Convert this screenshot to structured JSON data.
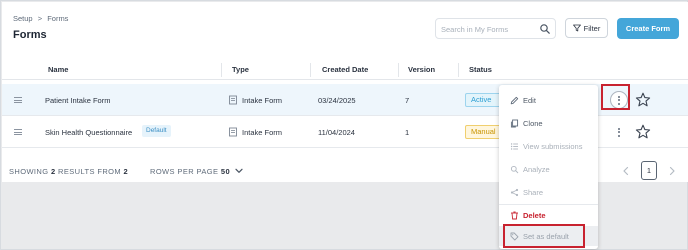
{
  "breadcrumb": {
    "root": "Setup",
    "separator": ">",
    "current": "Forms"
  },
  "page_title": "Forms",
  "search": {
    "placeholder": "Search in My Forms",
    "value": ""
  },
  "toolbar": {
    "filter_label": "Filter",
    "create_label": "Create Form"
  },
  "table": {
    "columns": [
      "Name",
      "Type",
      "Created Date",
      "Version",
      "Status"
    ],
    "rows": [
      {
        "name": "Patient Intake Form",
        "badge": "",
        "type": "Intake Form",
        "created": "03/24/2025",
        "version": "7",
        "status": "Active",
        "status_kind": "active"
      },
      {
        "name": "Skin Health Questionnaire",
        "badge": "Default",
        "type": "Intake Form",
        "created": "11/04/2024",
        "version": "1",
        "status": "Manual",
        "status_kind": "manual"
      }
    ]
  },
  "footer": {
    "showing": "SHOWING",
    "shown_count": "2",
    "results_from": "RESULTS FROM",
    "total": "2",
    "rows_per_page_label": "ROWS PER PAGE",
    "rows_per_page_value": "50",
    "current_page": "1"
  },
  "context_menu": {
    "items": [
      {
        "label": "Edit",
        "icon": "pencil-icon",
        "state": "enabled"
      },
      {
        "label": "Clone",
        "icon": "copy-icon",
        "state": "enabled"
      },
      {
        "label": "View submissions",
        "icon": "list-icon",
        "state": "disabled"
      },
      {
        "label": "Analyze",
        "icon": "analyze-icon",
        "state": "disabled"
      },
      {
        "label": "Share",
        "icon": "share-icon",
        "state": "disabled"
      },
      {
        "label": "Delete",
        "icon": "trash-icon",
        "state": "danger"
      },
      {
        "label": "Set as default",
        "icon": "tag-icon",
        "state": "disabled"
      }
    ]
  },
  "colors": {
    "accent": "#44a6d9",
    "highlight_row": "#eef6fc",
    "danger": "#c8222f",
    "active_status": "#2c9ed3",
    "manual_status": "#c99400"
  }
}
